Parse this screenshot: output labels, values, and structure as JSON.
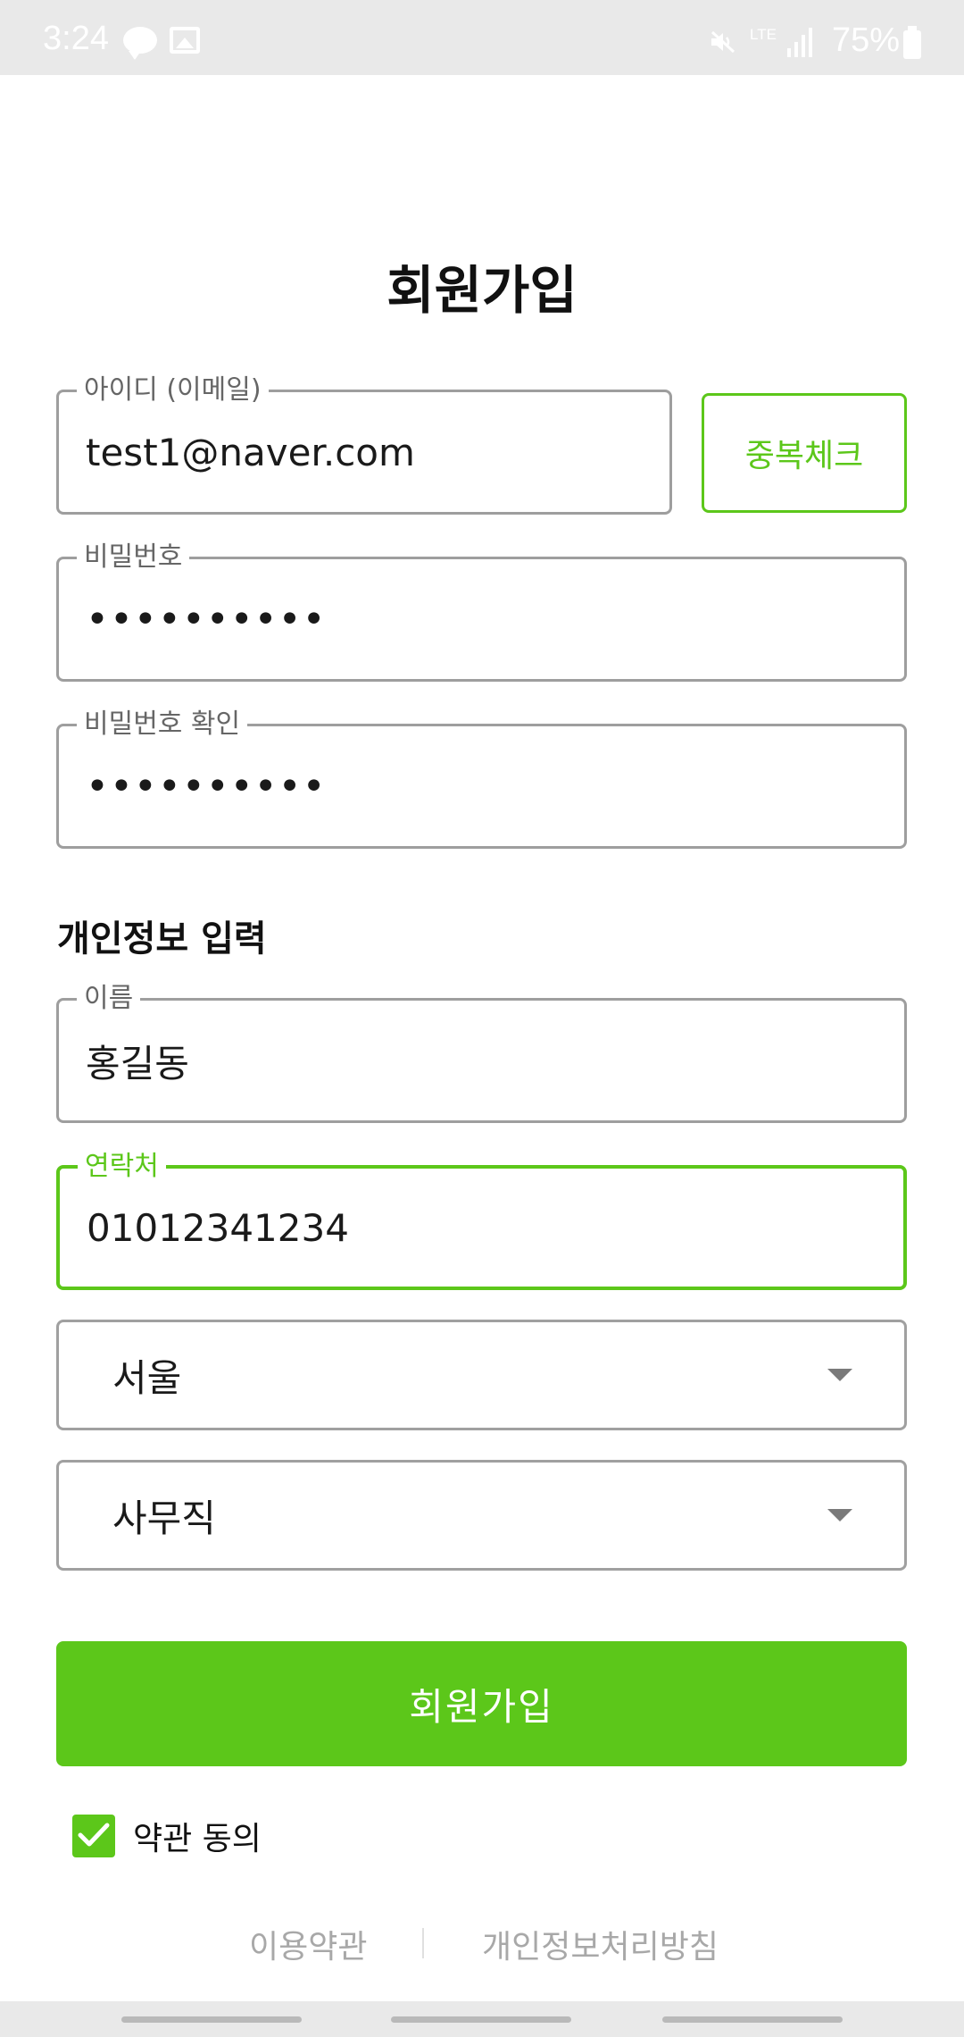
{
  "status_bar": {
    "time": "3:24",
    "network": "LTE",
    "battery": "75%",
    "icons": [
      "talk-icon",
      "gallery-icon",
      "mute-icon",
      "signal-icon",
      "battery-icon"
    ]
  },
  "page_title": "회원가입",
  "account": {
    "email": {
      "label": "아이디 (이메일)",
      "value": "test1@naver.com"
    },
    "dup_check_label": "중복체크",
    "password": {
      "label": "비밀번호",
      "value": "••••••••••"
    },
    "password_confirm": {
      "label": "비밀번호 확인",
      "value": "••••••••••"
    }
  },
  "personal": {
    "section_title": "개인정보 입력",
    "name": {
      "label": "이름",
      "value": "홍길동"
    },
    "phone": {
      "label": "연락처",
      "value": "01012341234"
    },
    "region": {
      "value": "서울"
    },
    "job": {
      "value": "사무직"
    }
  },
  "submit_label": "회원가입",
  "agree": {
    "label": "약관 동의",
    "checked": true
  },
  "footer": {
    "terms": "이용약관",
    "privacy": "개인정보처리방침"
  },
  "colors": {
    "accent": "#5cc71a",
    "border": "#9e9e9e",
    "muted": "#a8a8a8"
  }
}
